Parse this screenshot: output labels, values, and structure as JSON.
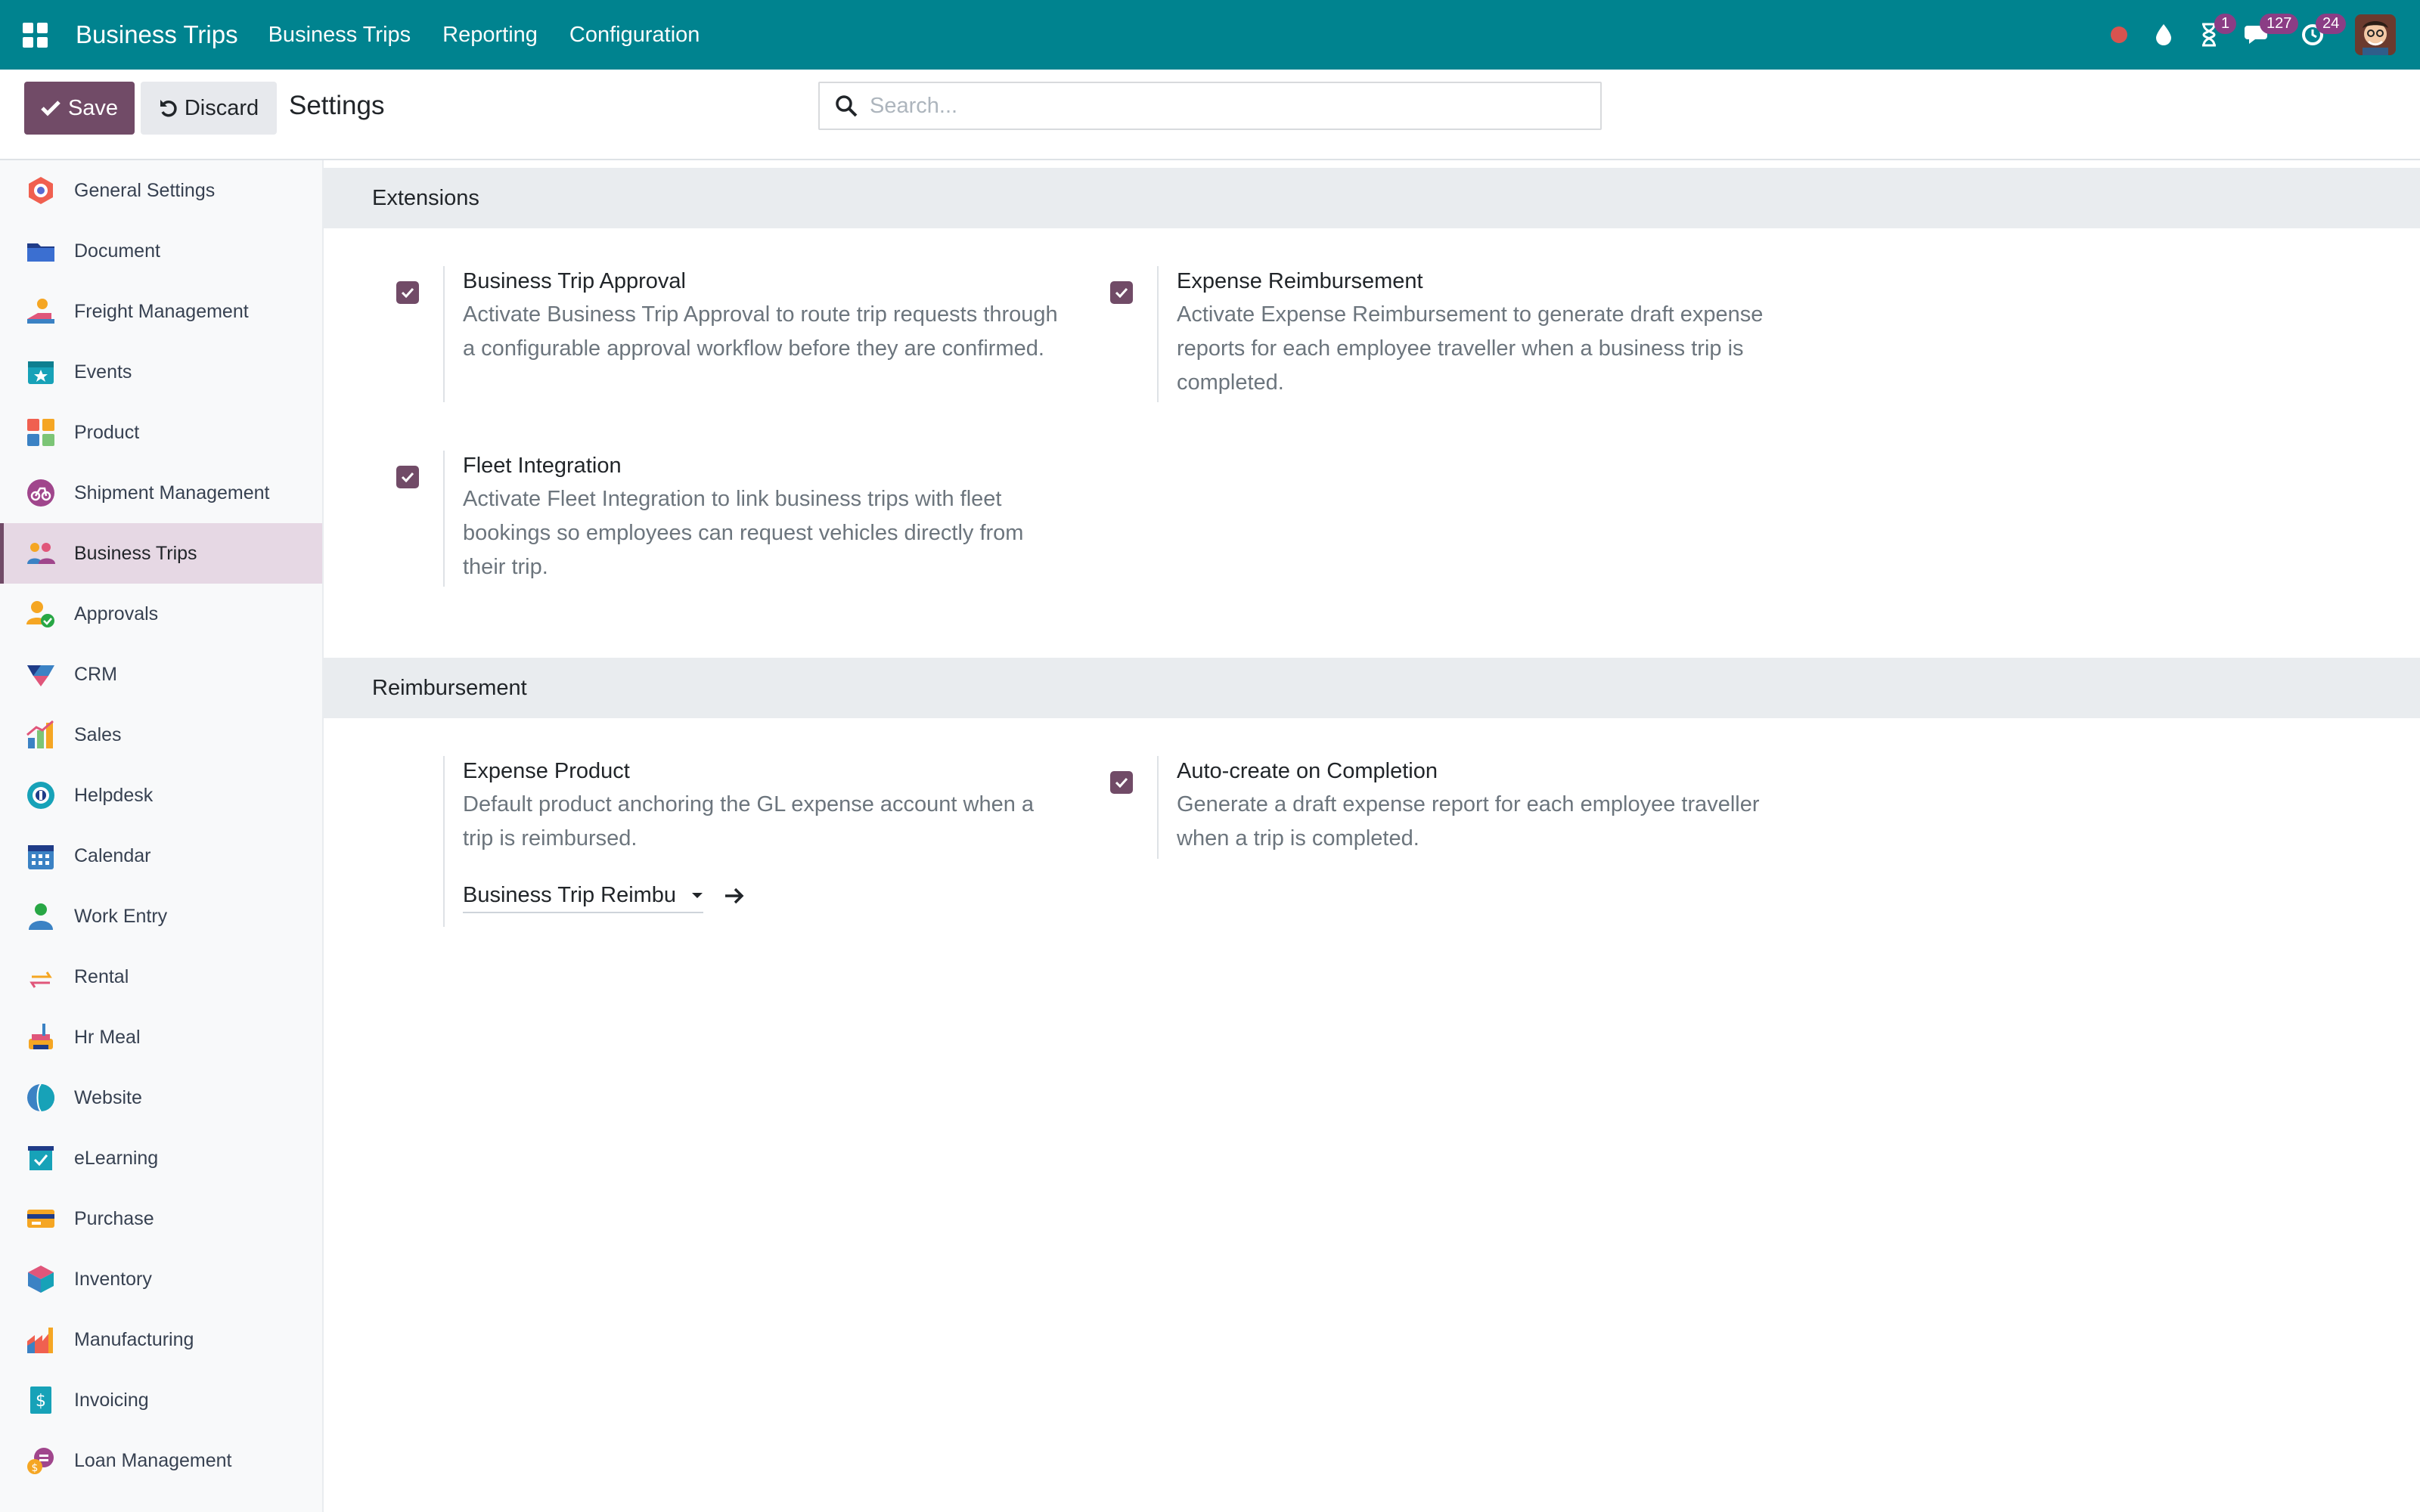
{
  "navbar": {
    "app_title": "Business Trips",
    "menu": [
      "Business Trips",
      "Reporting",
      "Configuration"
    ],
    "badges": {
      "activities": "1",
      "messages": "127",
      "updates": "24"
    }
  },
  "control_panel": {
    "save_label": "Save",
    "discard_label": "Discard",
    "title": "Settings",
    "search_placeholder": "Search..."
  },
  "sidebar": {
    "items": [
      {
        "label": "General Settings",
        "icon": "general-settings-icon"
      },
      {
        "label": "Document",
        "icon": "document-icon"
      },
      {
        "label": "Freight Management",
        "icon": "freight-icon"
      },
      {
        "label": "Events",
        "icon": "events-icon"
      },
      {
        "label": "Product",
        "icon": "product-icon"
      },
      {
        "label": "Shipment Management",
        "icon": "shipment-icon"
      },
      {
        "label": "Business Trips",
        "icon": "business-trips-icon",
        "active": true
      },
      {
        "label": "Approvals",
        "icon": "approvals-icon"
      },
      {
        "label": "CRM",
        "icon": "crm-icon"
      },
      {
        "label": "Sales",
        "icon": "sales-icon"
      },
      {
        "label": "Helpdesk",
        "icon": "helpdesk-icon"
      },
      {
        "label": "Calendar",
        "icon": "calendar-icon"
      },
      {
        "label": "Work Entry",
        "icon": "work-entry-icon"
      },
      {
        "label": "Rental",
        "icon": "rental-icon"
      },
      {
        "label": "Hr Meal",
        "icon": "hr-meal-icon"
      },
      {
        "label": "Website",
        "icon": "website-icon"
      },
      {
        "label": "eLearning",
        "icon": "elearning-icon"
      },
      {
        "label": "Purchase",
        "icon": "purchase-icon"
      },
      {
        "label": "Inventory",
        "icon": "inventory-icon"
      },
      {
        "label": "Manufacturing",
        "icon": "manufacturing-icon"
      },
      {
        "label": "Invoicing",
        "icon": "invoicing-icon"
      },
      {
        "label": "Loan Management",
        "icon": "loan-icon"
      }
    ]
  },
  "sections": {
    "extensions": {
      "title": "Extensions",
      "settings": [
        {
          "title": "Business Trip Approval",
          "desc": "Activate Business Trip Approval to route trip requests through a configurable approval workflow before they are confirmed.",
          "checked": true
        },
        {
          "title": "Expense Reimbursement",
          "desc": "Activate Expense Reimbursement to generate draft expense reports for each employee traveller when a business trip is completed.",
          "checked": true
        },
        {
          "title": "Fleet Integration",
          "desc": "Activate Fleet Integration to link business trips with fleet bookings so employees can request vehicles directly from their trip.",
          "checked": true
        }
      ]
    },
    "reimbursement": {
      "title": "Reimbursement",
      "expense_product": {
        "title": "Expense Product",
        "desc": "Default product anchoring the GL expense account when a trip is reimbursed.",
        "value": "Business Trip Reimbu"
      },
      "auto_create": {
        "title": "Auto-create on Completion",
        "desc": "Generate a draft expense report for each employee traveller when a trip is completed.",
        "checked": true
      }
    }
  },
  "colors": {
    "navbar": "#00838f",
    "primary": "#714b67",
    "badge": "#8b3d85",
    "active_sidebar": "#e6d8e4"
  }
}
